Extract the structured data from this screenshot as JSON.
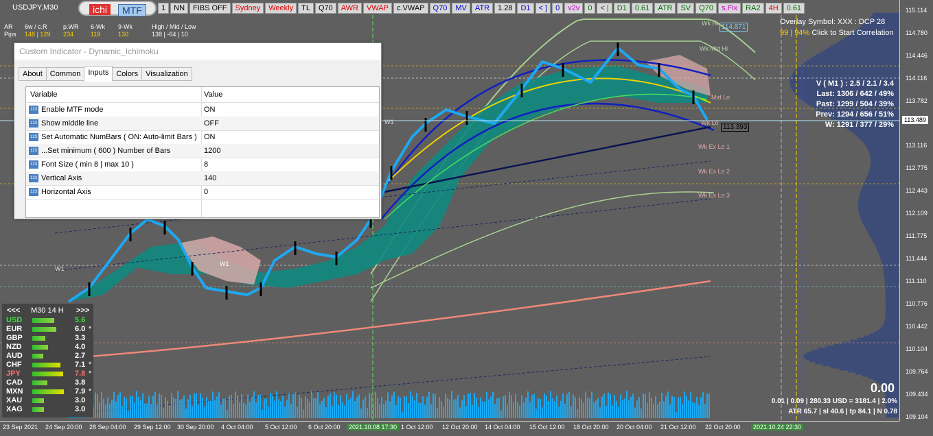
{
  "symbol_label": "USDJPY,M30",
  "toolbar": {
    "ichi": "ichi",
    "mtf": "MTF",
    "buttons": [
      {
        "label": "1",
        "style": ""
      },
      {
        "label": "NN",
        "style": ""
      },
      {
        "label": "FIBS OFF",
        "style": ""
      },
      {
        "label": "Sydney",
        "style": "red"
      },
      {
        "label": "Weekly",
        "style": "red"
      },
      {
        "label": "TL",
        "style": ""
      },
      {
        "label": "Q70",
        "style": ""
      },
      {
        "label": "AWR",
        "style": "red"
      },
      {
        "label": "VWAP",
        "style": "red"
      },
      {
        "label": "c.VWAP",
        "style": ""
      },
      {
        "label": "Q70",
        "style": "blue"
      },
      {
        "label": "MV",
        "style": "blue"
      },
      {
        "label": "ATR",
        "style": "blue"
      },
      {
        "label": "1.28",
        "style": ""
      },
      {
        "label": "D1",
        "style": "blue"
      },
      {
        "label": "< ]",
        "style": "blue"
      },
      {
        "label": "0",
        "style": "blue"
      },
      {
        "label": "v2v",
        "style": "mag"
      },
      {
        "label": "0",
        "style": "green"
      },
      {
        "label": "< |",
        "style": "green"
      },
      {
        "label": "D1",
        "style": "green"
      },
      {
        "label": "0.61",
        "style": "green"
      },
      {
        "label": "ATR",
        "style": "green"
      },
      {
        "label": "SV",
        "style": "green"
      },
      {
        "label": "Q70",
        "style": "green"
      },
      {
        "label": "s.Fix",
        "style": "mag"
      },
      {
        "label": "RA2",
        "style": "green"
      },
      {
        "label": "4H",
        "style": "red"
      },
      {
        "label": "0.61",
        "style": "green"
      }
    ]
  },
  "info": {
    "row1": [
      "AR",
      "6w / c.R",
      "p.WR",
      "6-Wk",
      "9-Wk",
      "High / Mid / Low"
    ],
    "row2": [
      "Pips",
      "148 | 129",
      "234",
      "119",
      "130",
      "138 | -64 | 10"
    ]
  },
  "dialog": {
    "title": "Custom Indicator - Dynamic_Ichimoku",
    "tabs": [
      "About",
      "Common",
      "Inputs",
      "Colors",
      "Visualization"
    ],
    "active_tab": "Inputs",
    "col_variable": "Variable",
    "col_value": "Value",
    "icon_text": "123",
    "rows": [
      {
        "variable": "Enable MTF mode",
        "value": "ON"
      },
      {
        "variable": "Show middle line",
        "value": "OFF"
      },
      {
        "variable": "Set Automatic NumBars ( ON: Auto-limit Bars )",
        "value": "ON"
      },
      {
        "variable": "...Set minimum ( 600 ) Number of Bars",
        "value": "1200"
      },
      {
        "variable": "Font Size ( min 8  |  max 10 )",
        "value": "8"
      },
      {
        "variable": "Vertical Axis",
        "value": "140"
      },
      {
        "variable": "Horizontal Axis",
        "value": "0"
      }
    ]
  },
  "currency_panel": {
    "nav_prev": "<<<",
    "timeframe": "M30  14  H",
    "nav_next": ">>>",
    "rows": [
      {
        "code": "USD",
        "value": "5.6",
        "mark": "",
        "color": "#40e040",
        "bar": 0.56
      },
      {
        "code": "EUR",
        "value": "6.0",
        "mark": "*",
        "color": "#ffffff",
        "bar": 0.6
      },
      {
        "code": "GBP",
        "value": "3.3",
        "mark": "",
        "color": "#ffffff",
        "bar": 0.33
      },
      {
        "code": "NZD",
        "value": "4.0",
        "mark": "",
        "color": "#ffffff",
        "bar": 0.4
      },
      {
        "code": "AUD",
        "value": "2.7",
        "mark": "",
        "color": "#ffffff",
        "bar": 0.27
      },
      {
        "code": "CHF",
        "value": "7.1",
        "mark": "*",
        "color": "#ffffff",
        "bar": 0.71
      },
      {
        "code": "JPY",
        "value": "7.8",
        "mark": "*",
        "color": "#ff7070",
        "bar": 0.78
      },
      {
        "code": "CAD",
        "value": "3.8",
        "mark": "",
        "color": "#ffffff",
        "bar": 0.38
      },
      {
        "code": "MXN",
        "value": "7.9",
        "mark": "*",
        "color": "#ffffff",
        "bar": 0.79
      },
      {
        "code": "XAU",
        "value": "3.0",
        "mark": "",
        "color": "#ffffff",
        "bar": 0.3
      },
      {
        "code": "XAG",
        "value": "3.0",
        "mark": "",
        "color": "#ffffff",
        "bar": 0.3
      }
    ]
  },
  "overlay": {
    "line1": "Overlay Symbol: XXX : DCP 28",
    "line2_a": "99",
    "line2_b": "94%",
    "line2_c": "Click to Start Correlation"
  },
  "stats": {
    "v": "V ( M1 ) : 2.5 / 2.1 / 3.4",
    "last": "Last: 1306 / 642 / 49%",
    "past": "Past: 1299 / 504 / 39%",
    "prev": "Prev: 1294 / 656 / 51%",
    "w": "W: 1291 / 377 / 29%"
  },
  "bottom_right": {
    "big": "0.00",
    "line1": "0.01  |  0.09  |  280.33 USD = 3181.4  |  2.0%",
    "line2": "ATR 65.7  |  sl 40.6  |  tp 84.1  |  N 0.78"
  },
  "labels": {
    "wk_hi": "Wk Hi",
    "wk_hi_val": "114.871",
    "wk_mid_hi": "Wk Mid Hi",
    "mid_lo": "Mid Lo",
    "wk_lo": "Wk Lo",
    "wk_ex_lo1": "Wk Ex Lo 1",
    "wk_ex_lo2": "Wk Ex Lo 2",
    "wk_ex_lo3": "Wk Ex Lo 3",
    "price_tag": "113.393",
    "w1a": "W1",
    "w1b": "W1",
    "w1c": "W1"
  },
  "price_axis": {
    "ticks": [
      "115.114",
      "114.780",
      "114.446",
      "114.116",
      "113.782",
      "113.489",
      "113.116",
      "112.775",
      "112.443",
      "112.109",
      "111.775",
      "111.444",
      "111.110",
      "110.776",
      "110.442",
      "110.104",
      "109.764",
      "109.434",
      "109.104"
    ],
    "current": "113.489"
  },
  "time_axis": {
    "ticks": [
      "23 Sep 2021",
      "24 Sep 20:00",
      "28 Sep 04:00",
      "29 Sep 12:00",
      "30 Sep 20:00",
      "4 Oct 04:00",
      "5 Oct 12:00",
      "6 Oct 20:00",
      "2021.10.08 17:30",
      "1 Oct 12:00",
      "12 Oct 20:00",
      "14 Oct 04:00",
      "15 Oct 12:00",
      "18 Oct 20:00",
      "20 Oct 04:00",
      "21 Oct 12:00",
      "22 Oct 20:00",
      "2021.10.24 22:30"
    ],
    "highlight": [
      "2021.10.08 17:30",
      "2021.10.24 22:30"
    ]
  },
  "colors": {
    "background": "#5f5f5f",
    "candle_up": "#1ea8f0",
    "candle_down": "#000000",
    "cloud_bull": "#108a80",
    "cloud_bear": "#d8a8a8",
    "arc": "#1020c0",
    "yellow_curve": "#f0d000",
    "salmon_ma": "#f08878"
  }
}
